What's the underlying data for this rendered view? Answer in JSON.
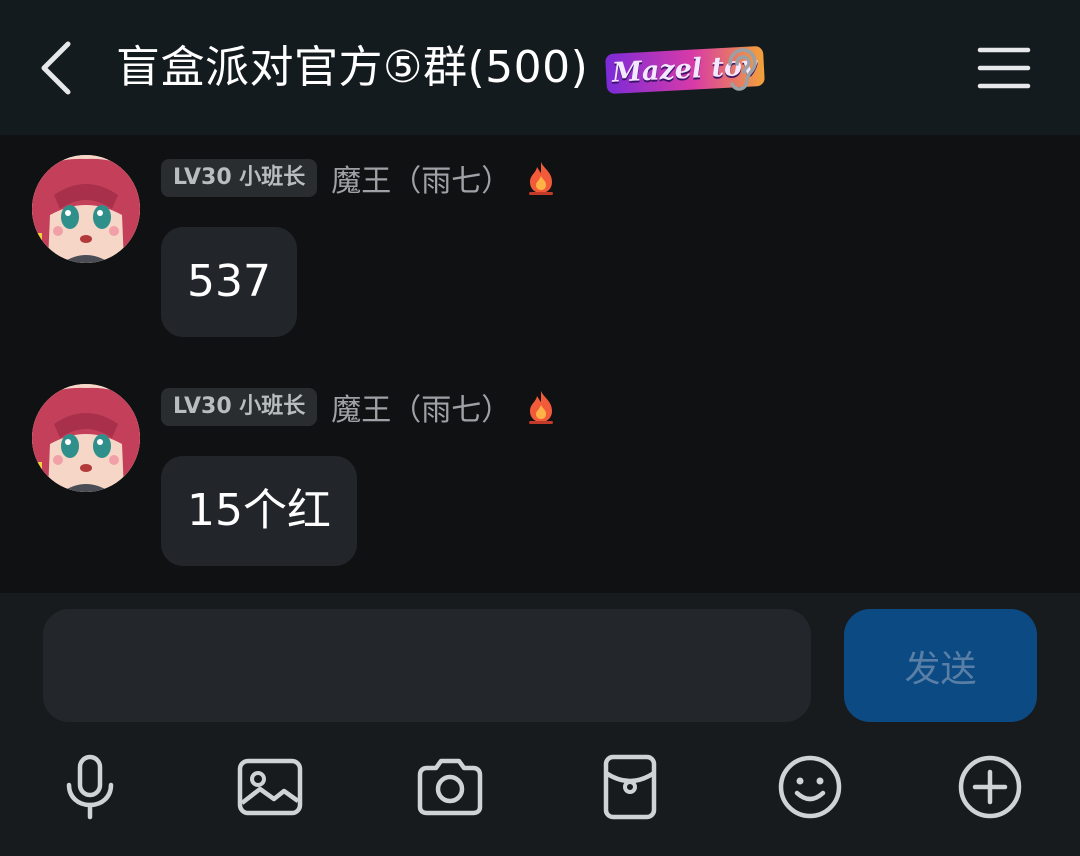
{
  "header": {
    "title": "盲盒派对官方⑤群(500)",
    "badge_text": "Mazel tov",
    "icons": {
      "back": "chevron-left-icon",
      "listen": "ear-icon",
      "menu": "hamburger-menu-icon"
    }
  },
  "messages": [
    {
      "level": "LV30 小班长",
      "sender": "魔王（雨七）",
      "text": "537"
    },
    {
      "level": "LV30 小班长",
      "sender": "魔王（雨七）",
      "text": "15个红"
    }
  ],
  "composer": {
    "input_value": "",
    "send_label": "发送",
    "toolbar": [
      "microphone-icon",
      "image-icon",
      "camera-icon",
      "red-packet-icon",
      "emoji-icon",
      "plus-icon"
    ]
  },
  "colors": {
    "header_bg": "#141b1f",
    "chat_bg": "#101112",
    "bubble_bg": "#22262b",
    "send_bg": "#0b4a82",
    "send_text": "#5a7fa6"
  }
}
